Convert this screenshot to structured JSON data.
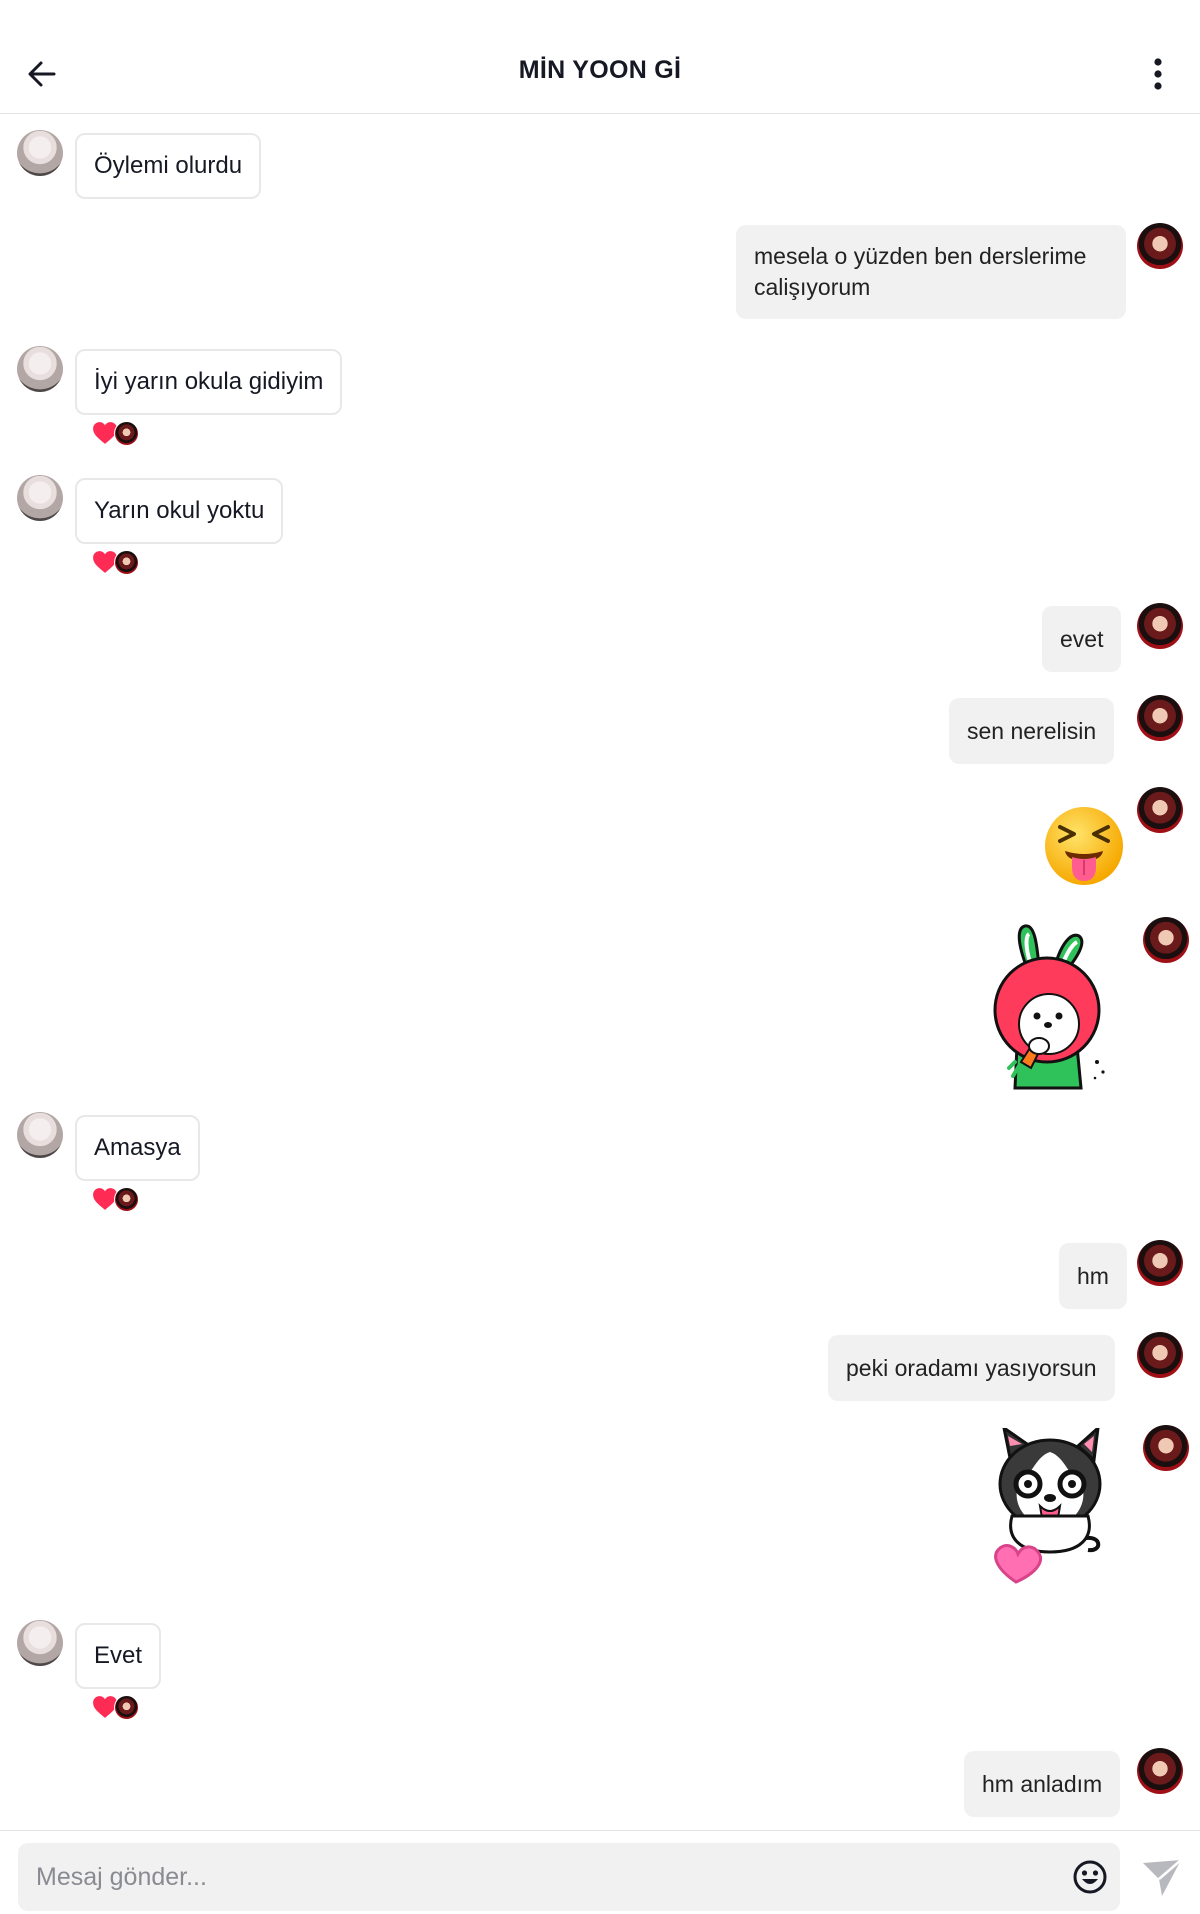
{
  "header": {
    "title": "MİN YOON Gİ",
    "back_icon": "arrow-left-icon",
    "more_icon": "more-vertical-icon"
  },
  "colors": {
    "reaction_heart": "#fe2c55",
    "incoming_bubble_border": "#e8e8e9",
    "outgoing_bubble_bg": "#f1f1f2"
  },
  "messages": [
    {
      "from": "other",
      "type": "text",
      "text": "Öylemi olurdu",
      "reaction": null
    },
    {
      "from": "me",
      "type": "text",
      "text": "mesela o yüzden ben derslerime calişıyorum"
    },
    {
      "from": "other",
      "type": "text",
      "text": "İyi yarın okula gidiyim",
      "reaction": "heart-icon"
    },
    {
      "from": "other",
      "type": "text",
      "text": "Yarın okul yoktu",
      "reaction": "heart-icon"
    },
    {
      "from": "me",
      "type": "text",
      "text": "evet"
    },
    {
      "from": "me",
      "type": "text",
      "text": "sen nerelisin"
    },
    {
      "from": "me",
      "type": "sticker",
      "sticker": "squinting-tongue-emoji"
    },
    {
      "from": "me",
      "type": "sticker",
      "sticker": "bunny-with-carrot-sticker"
    },
    {
      "from": "other",
      "type": "text",
      "text": "Amasya",
      "reaction": "heart-icon"
    },
    {
      "from": "me",
      "type": "text",
      "text": "hm"
    },
    {
      "from": "me",
      "type": "text",
      "text": "peki oradamı yasıyorsun"
    },
    {
      "from": "me",
      "type": "sticker",
      "sticker": "husky-dog-with-heart-sticker"
    },
    {
      "from": "other",
      "type": "text",
      "text": "Evet",
      "reaction": "heart-icon"
    },
    {
      "from": "me",
      "type": "text",
      "text": "hm anladım"
    }
  ],
  "composer": {
    "placeholder": "Mesaj gönder...",
    "emoji_icon": "smiley-icon",
    "send_icon": "send-icon"
  }
}
